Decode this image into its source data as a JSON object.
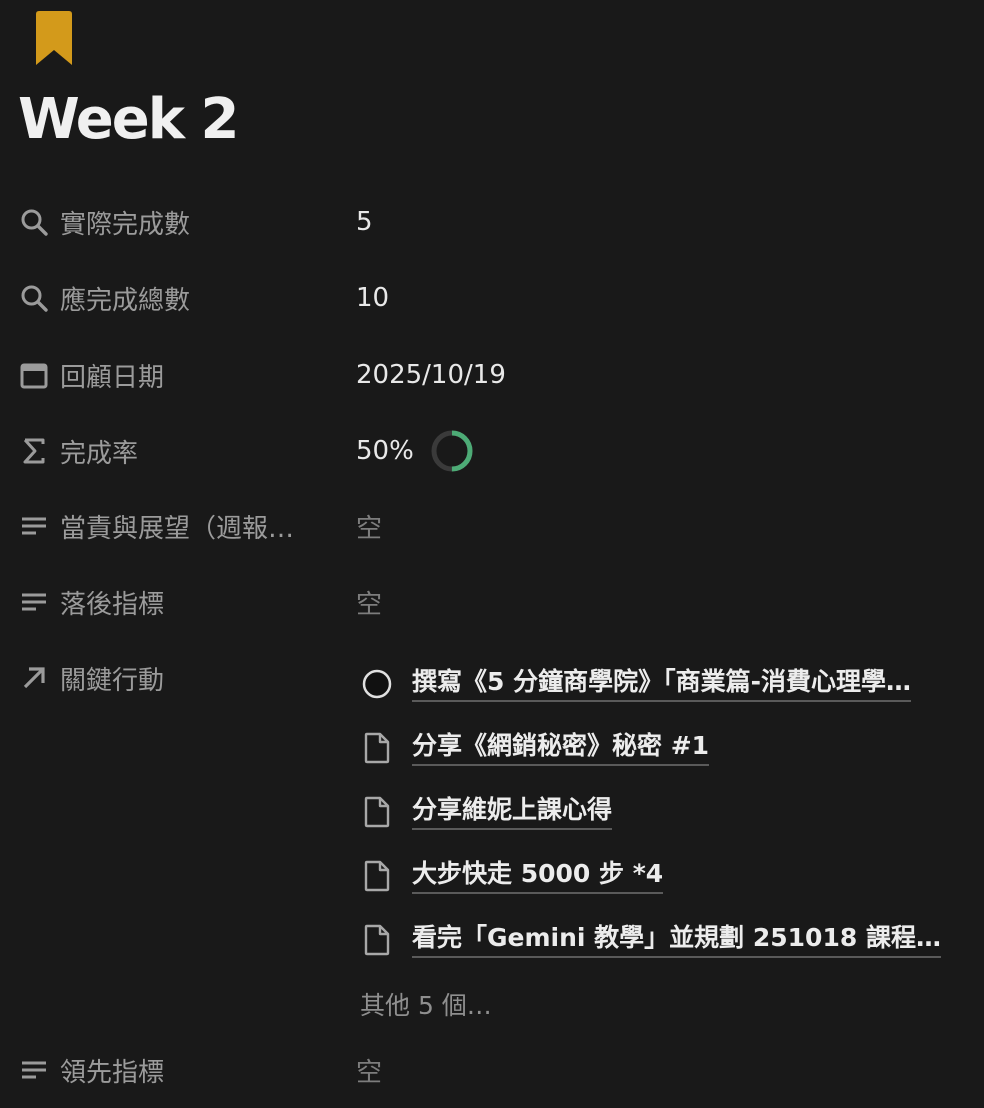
{
  "page": {
    "icon": "bookmark-icon",
    "icon_color": "#D39A1B",
    "title": "Week 2"
  },
  "properties": [
    {
      "icon": "search-icon",
      "name": "實際完成數",
      "value": "5"
    },
    {
      "icon": "search-icon",
      "name": "應完成總數",
      "value": "10"
    },
    {
      "icon": "calendar-icon",
      "name": "回顧日期",
      "value": "2025/10/19"
    },
    {
      "icon": "sigma-icon",
      "name": "完成率",
      "value": "50%",
      "progress": 0.5,
      "progress_color": "#4DAB76"
    },
    {
      "icon": "text-lines-icon",
      "name": "當責與展望（週報…",
      "value": "空"
    },
    {
      "icon": "text-lines-icon",
      "name": "落後指標",
      "value": "空"
    },
    {
      "icon": "arrow-up-right-icon",
      "name": "關鍵行動"
    },
    {
      "icon": "text-lines-icon",
      "name": "領先指標",
      "value": "空"
    }
  ],
  "relations": {
    "items": [
      {
        "icon": "circle-icon",
        "label": "撰寫《5 分鐘商學院》「商業篇-消費心理學…"
      },
      {
        "icon": "document-icon",
        "label": "分享《網銷秘密》秘密 #1"
      },
      {
        "icon": "document-icon",
        "label": "分享維妮上課心得"
      },
      {
        "icon": "document-icon",
        "label": "大步快走 5000 步 *4"
      },
      {
        "icon": "document-icon",
        "label": "看完「Gemini 教學」並規劃 251018 課程…"
      }
    ],
    "more_label": "其他 5 個…"
  }
}
